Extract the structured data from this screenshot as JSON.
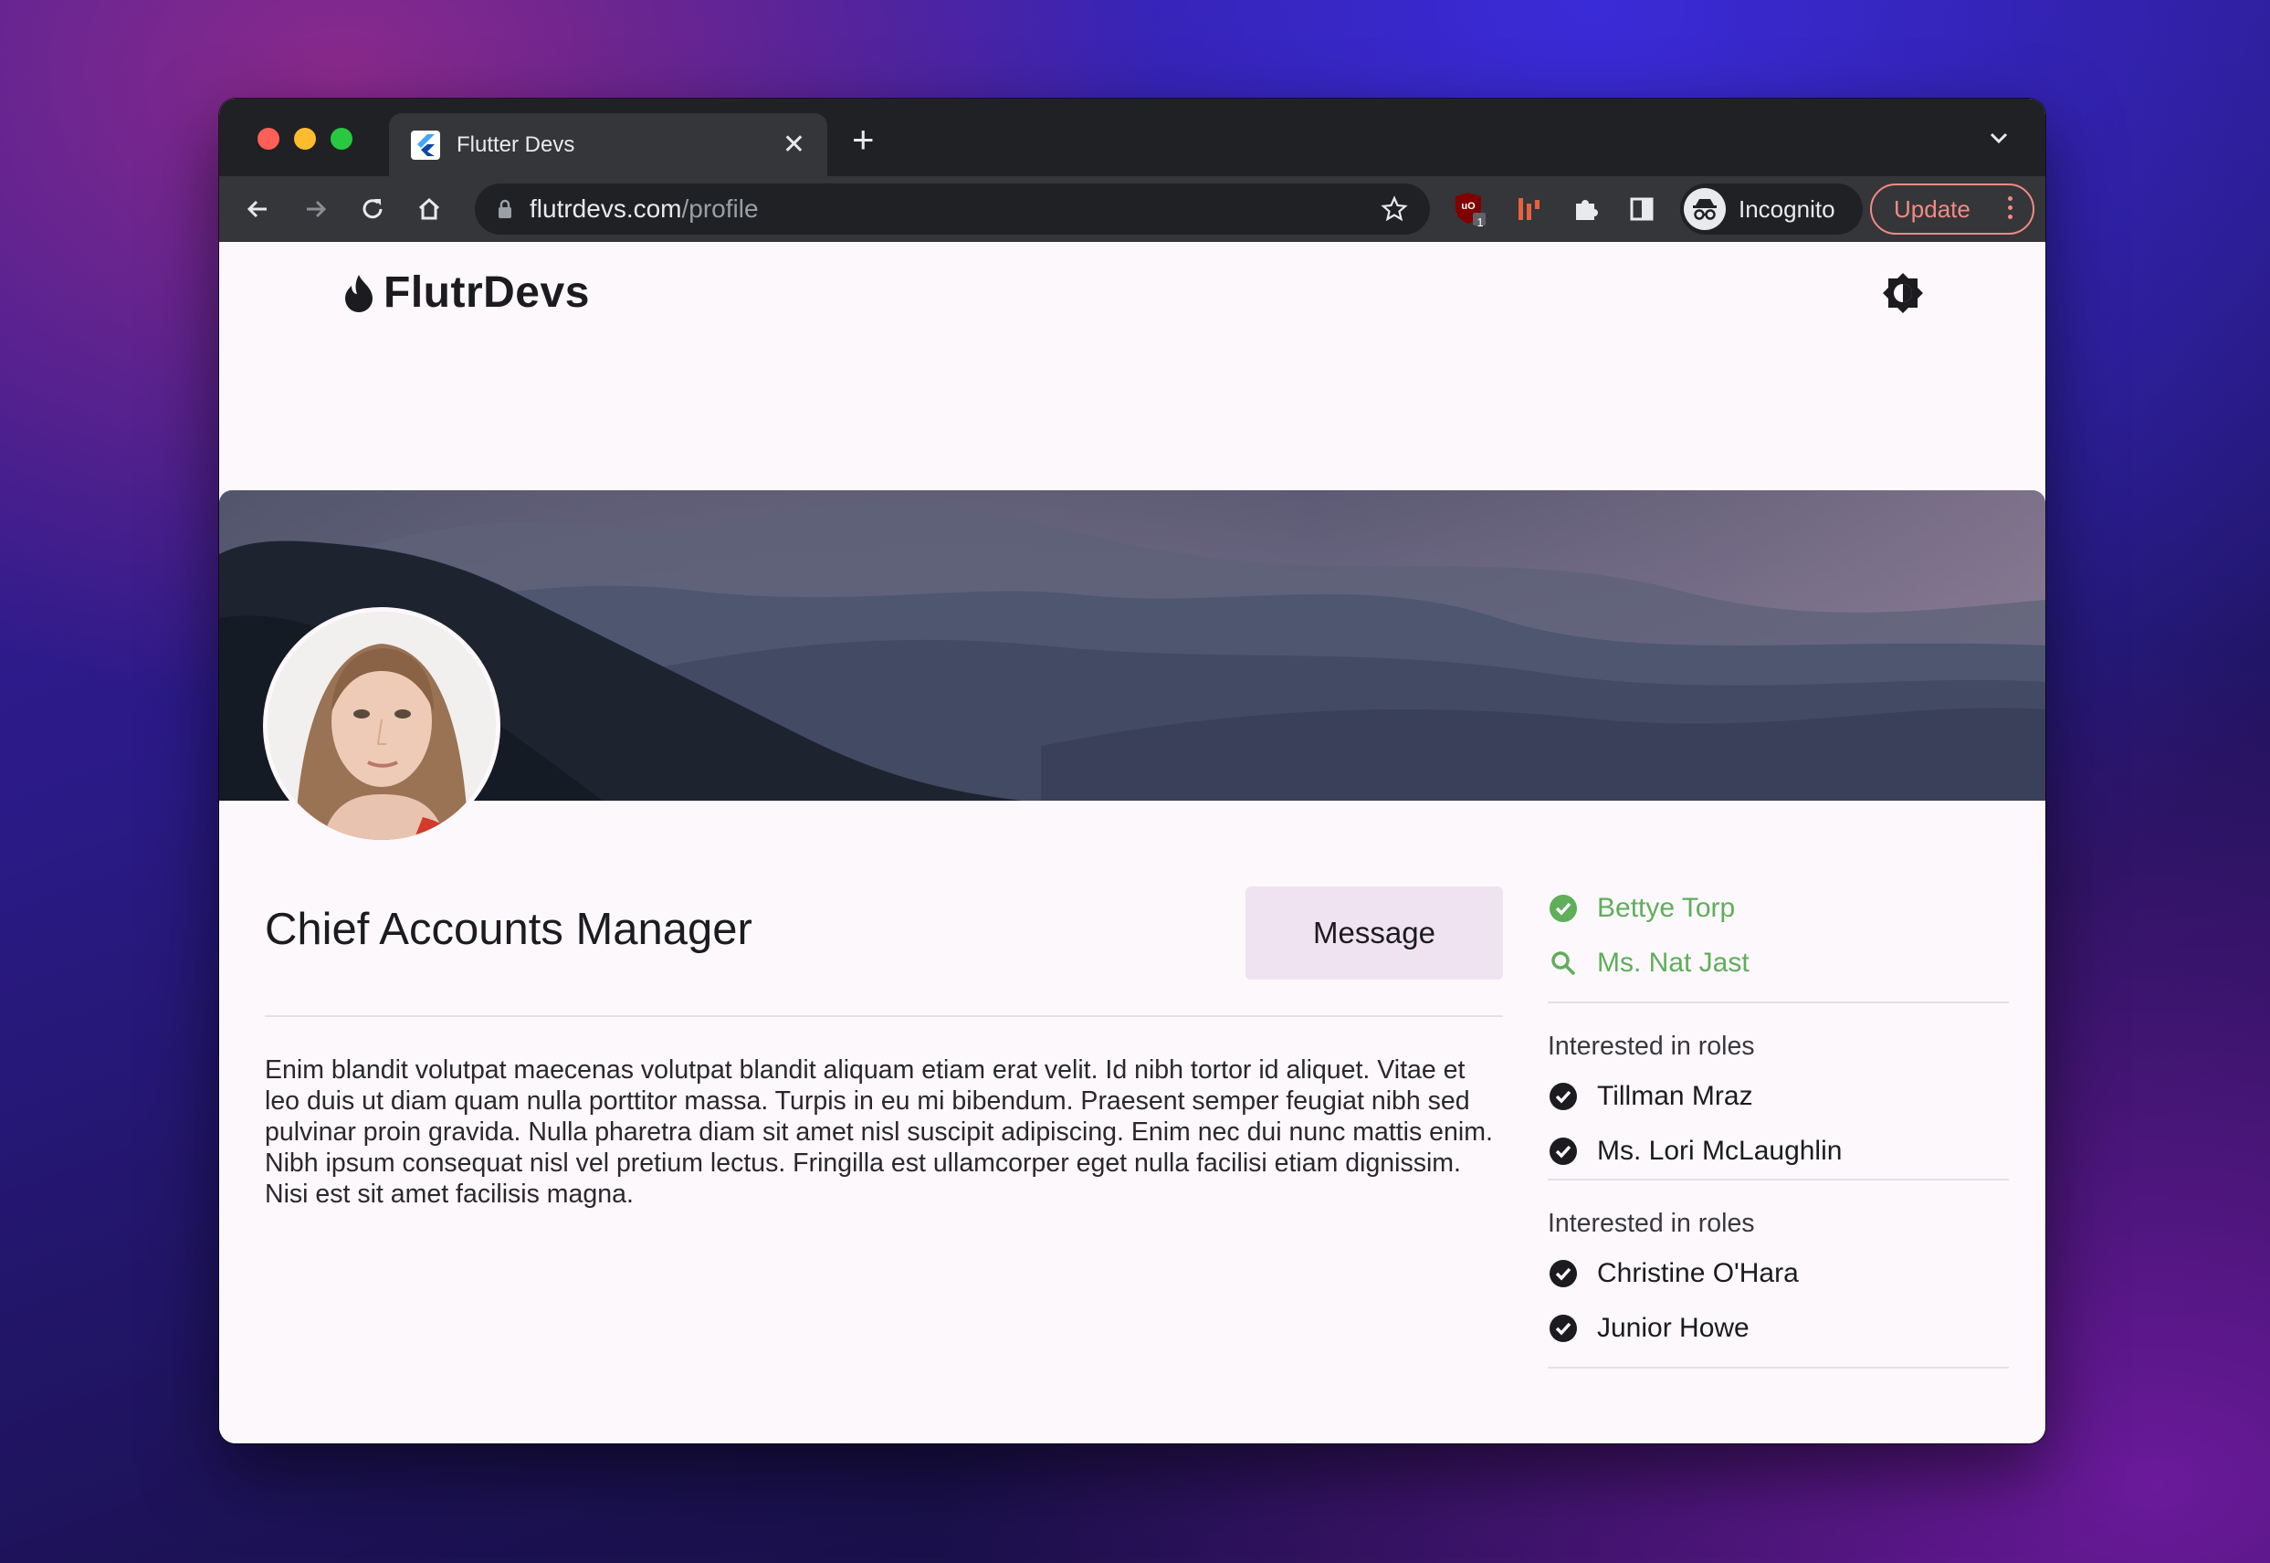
{
  "browser": {
    "tab_title": "Flutter Devs",
    "url_host": "flutrdevs.com",
    "url_path": "/profile",
    "incognito_label": "Incognito",
    "update_label": "Update",
    "extension_badge": "1"
  },
  "app": {
    "brand": "FlutrDevs"
  },
  "profile": {
    "title": "Chief Accounts Manager",
    "message_label": "Message",
    "bio": "Enim blandit volutpat maecenas volutpat blandit aliquam etiam erat velit. Id nibh tortor id aliquet. Vitae et leo duis ut diam quam nulla porttitor massa. Turpis in eu mi bibendum. Praesent semper feugiat nibh sed pulvinar proin gravida. Nulla pharetra diam sit amet nisl suscipit adipiscing. Enim nec dui nunc mattis enim. Nibh ipsum consequat nisl vel pretium lectus. Fringilla est ullamcorper eget nulla facilisi etiam dignissim. Nisi est sit amet facilisis magna."
  },
  "sidebar": {
    "status": [
      {
        "icon": "check-circle-icon",
        "name": "Bettye Torp"
      },
      {
        "icon": "search-icon",
        "name": "Ms. Nat Jast"
      }
    ],
    "groups": [
      {
        "heading": "Interested in roles",
        "items": [
          "Tillman Mraz",
          "Ms. Lori McLaughlin"
        ]
      },
      {
        "heading": "Interested in roles",
        "items": [
          "Christine O'Hara",
          "Junior Howe"
        ]
      }
    ],
    "accent_color": "#5fae5a"
  }
}
